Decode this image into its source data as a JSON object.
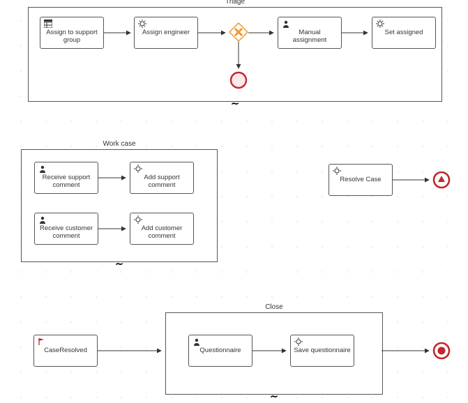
{
  "triage": {
    "title": "Triage",
    "tasks": {
      "assign_group": "Assign to support group",
      "assign_eng": "Assign engineer",
      "manual_assignment": "Manual assignment",
      "set_assigned": "Set assigned"
    }
  },
  "workcase": {
    "title": "Work case",
    "tasks": {
      "recv_support": "Receive support comment",
      "add_support": "Add support comment",
      "recv_customer": "Receive customer comment",
      "add_customer": "Add customer comment"
    }
  },
  "resolve": {
    "label": "Resolve Case"
  },
  "close": {
    "title": "Close",
    "event_label": "CaseResolved",
    "tasks": {
      "questionnaire": "Questionnaire",
      "save_q": "Save questionnaire"
    }
  }
}
